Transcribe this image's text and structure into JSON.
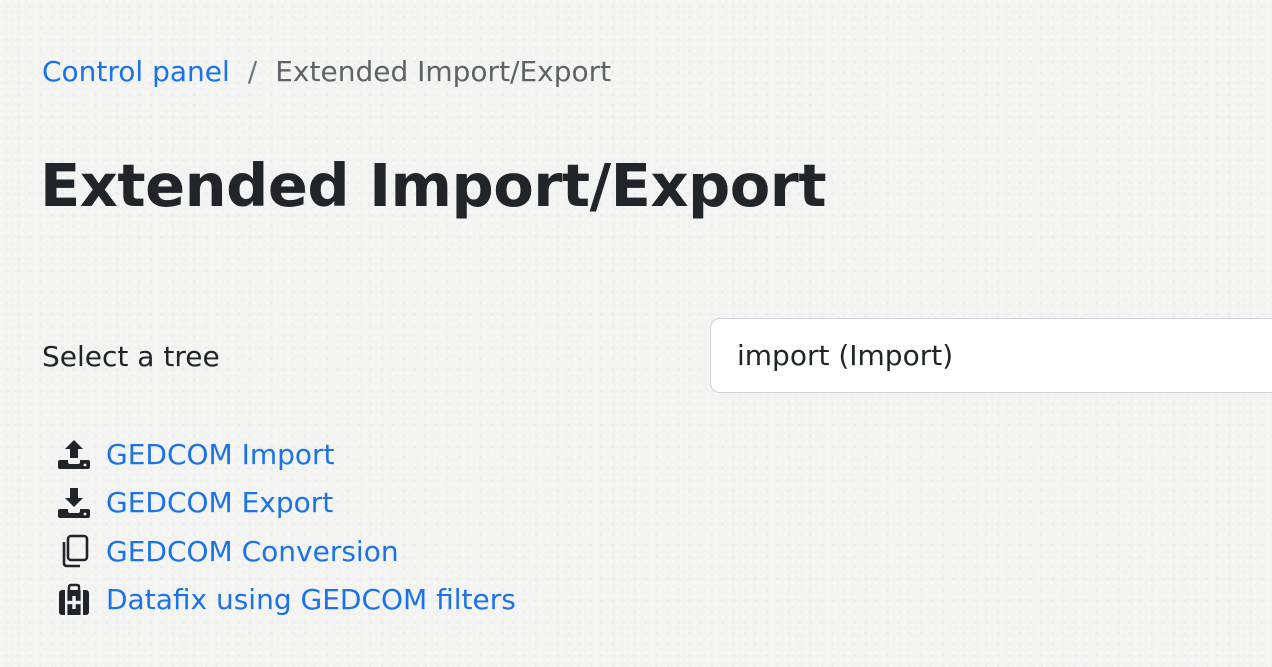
{
  "breadcrumb": {
    "home_label": "Control panel",
    "separator": "/",
    "current_label": "Extended Import/Export"
  },
  "page": {
    "title": "Extended Import/Export"
  },
  "tree_selector": {
    "label": "Select a tree",
    "selected_value": "import (Import)"
  },
  "menu": {
    "items": [
      {
        "label": "GEDCOM Import",
        "icon": "upload-icon"
      },
      {
        "label": "GEDCOM Export",
        "icon": "download-icon"
      },
      {
        "label": "GEDCOM Conversion",
        "icon": "copy-icon"
      },
      {
        "label": "Datafix using GEDCOM filters",
        "icon": "first-aid-kit-icon"
      }
    ]
  },
  "colors": {
    "link": "#1a73e8",
    "text": "#212529",
    "background": "#f3f3f2",
    "input_border": "#ced4da"
  }
}
